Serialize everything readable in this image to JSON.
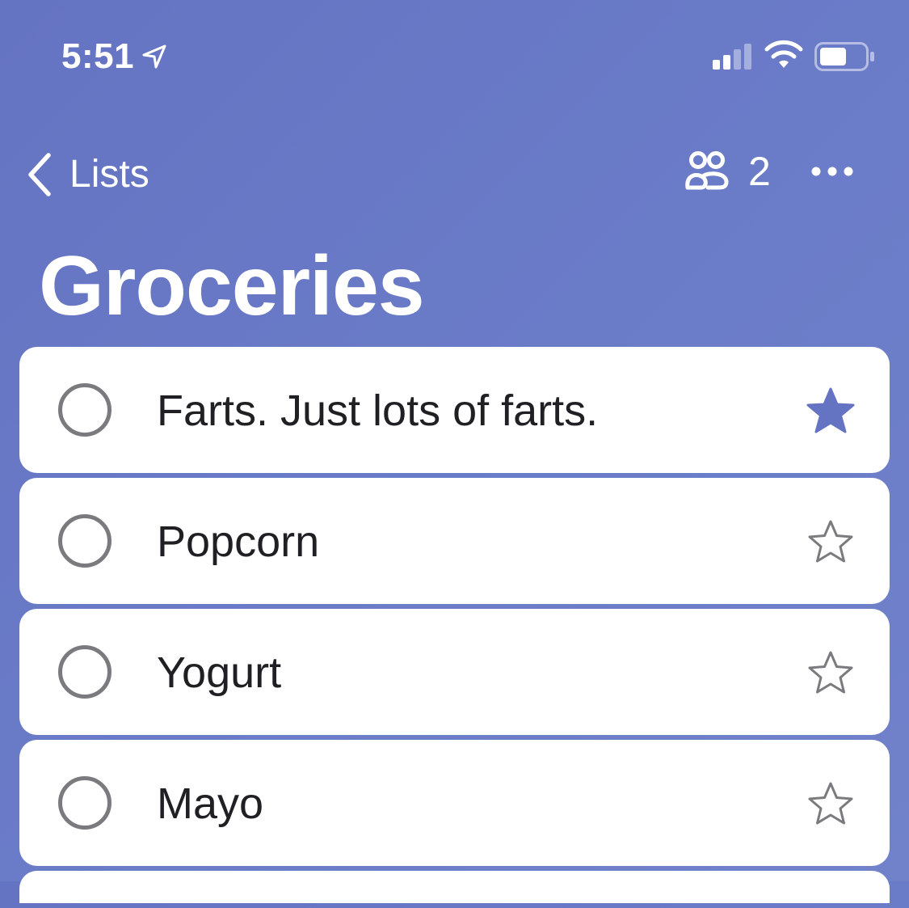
{
  "status_bar": {
    "time": "5:51",
    "icons": [
      "location-arrow-icon",
      "cellular-signal-icon",
      "wifi-icon",
      "battery-icon"
    ]
  },
  "nav": {
    "back_label": "Lists",
    "back_icon": "chevron-left-icon",
    "share_icon": "people-icon",
    "share_count": "2",
    "more_icon": "ellipsis-icon"
  },
  "title": "Groceries",
  "colors": {
    "background": "#6a7bc8",
    "accent": "#6574c2",
    "card": "#ffffff",
    "text": "#1f1f24",
    "secondary": "#7b7b7f"
  },
  "items": [
    {
      "text": "Farts. Just lots of farts.",
      "starred": true
    },
    {
      "text": "Popcorn",
      "starred": false
    },
    {
      "text": "Yogurt",
      "starred": false
    },
    {
      "text": "Mayo",
      "starred": false
    }
  ]
}
